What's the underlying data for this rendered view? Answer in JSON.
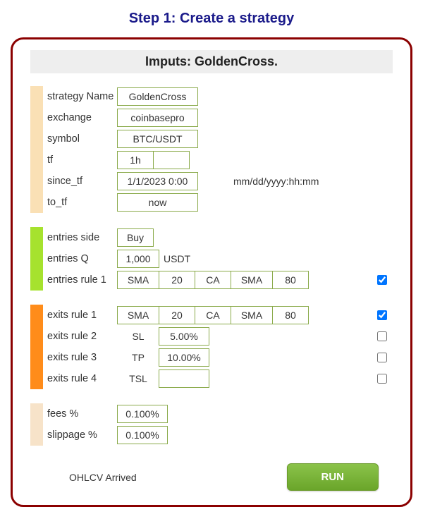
{
  "pageTitle": "Step 1: Create a strategy",
  "inputsHeader": "Imputs:  GoldenCross.",
  "config": {
    "strategyName": {
      "label": "strategy Name",
      "value": "GoldenCross"
    },
    "exchange": {
      "label": "exchange",
      "value": "coinbasepro"
    },
    "symbol": {
      "label": "symbol",
      "value": "BTC/USDT"
    },
    "tf": {
      "label": "tf",
      "value": "1h"
    },
    "sinceTf": {
      "label": "since_tf",
      "value": "1/1/2023 0:00",
      "hint": "mm/dd/yyyy:hh:mm"
    },
    "toTf": {
      "label": "to_tf",
      "value": "now"
    }
  },
  "entries": {
    "side": {
      "label": "entries side",
      "value": "Buy"
    },
    "q": {
      "label": "entries Q",
      "value": "1,000",
      "unit": "USDT"
    },
    "rule1": {
      "label": "entries rule 1",
      "cells": [
        "SMA",
        "20",
        "CA",
        "SMA",
        "80"
      ],
      "checked": true
    }
  },
  "exits": {
    "rule1": {
      "label": "exits rule 1",
      "cells": [
        "SMA",
        "20",
        "CA",
        "SMA",
        "80"
      ],
      "checked": true
    },
    "rule2": {
      "label": "exits rule 2",
      "type": "SL",
      "value": "5.00%",
      "checked": false
    },
    "rule3": {
      "label": "exits rule 3",
      "type": "TP",
      "value": "10.00%",
      "checked": false
    },
    "rule4": {
      "label": "exits rule 4",
      "type": "TSL",
      "value": "",
      "checked": false
    }
  },
  "costs": {
    "fees": {
      "label": "fees %",
      "value": "0.100%"
    },
    "slippage": {
      "label": "slippage %",
      "value": "0.100%"
    }
  },
  "status": "OHLCV Arrived",
  "runLabel": "RUN"
}
